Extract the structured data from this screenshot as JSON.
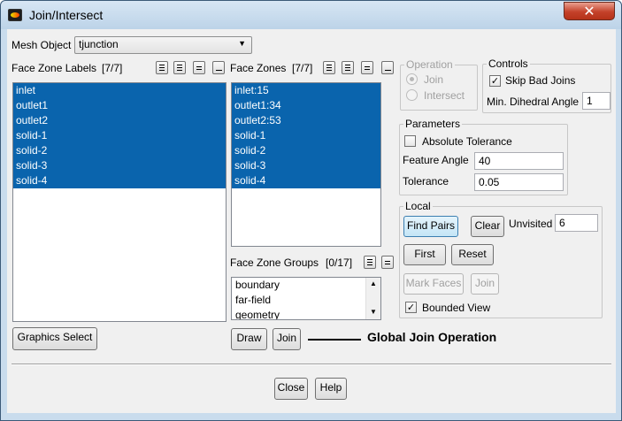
{
  "window": {
    "title": "Join/Intersect",
    "close_glyph": "✕"
  },
  "mesh_object": {
    "label": "Mesh Object",
    "value": "tjunction"
  },
  "face_zone_labels": {
    "label": "Face Zone Labels",
    "count": "[7/7]",
    "items": [
      {
        "text": "inlet",
        "selected": true
      },
      {
        "text": "outlet1",
        "selected": true
      },
      {
        "text": "outlet2",
        "selected": true
      },
      {
        "text": "solid-1",
        "selected": true
      },
      {
        "text": "solid-2",
        "selected": true
      },
      {
        "text": "solid-3",
        "selected": true
      },
      {
        "text": "solid-4",
        "selected": true
      }
    ]
  },
  "face_zones": {
    "label": "Face Zones",
    "count": "[7/7]",
    "items": [
      {
        "text": "inlet:15",
        "selected": true
      },
      {
        "text": "outlet1:34",
        "selected": true
      },
      {
        "text": "outlet2:53",
        "selected": true
      },
      {
        "text": "solid-1",
        "selected": true
      },
      {
        "text": "solid-2",
        "selected": true
      },
      {
        "text": "solid-3",
        "selected": true
      },
      {
        "text": "solid-4",
        "selected": true
      }
    ]
  },
  "face_zone_groups": {
    "label": "Face Zone Groups",
    "count": "[0/17]",
    "items": [
      "boundary",
      "far-field",
      "geometry"
    ]
  },
  "operation": {
    "title": "Operation",
    "join_label": "Join",
    "intersect_label": "Intersect",
    "selected": "Join"
  },
  "controls": {
    "title": "Controls",
    "skip_bad_joins_label": "Skip Bad Joins",
    "skip_bad_joins_checked": true,
    "min_dihedral_angle_label": "Min. Dihedral Angle",
    "min_dihedral_angle_value": "1"
  },
  "parameters": {
    "title": "Parameters",
    "absolute_tolerance_label": "Absolute Tolerance",
    "absolute_tolerance_checked": false,
    "feature_angle_label": "Feature Angle",
    "feature_angle_value": "40",
    "tolerance_label": "Tolerance",
    "tolerance_value": "0.05"
  },
  "local": {
    "title": "Local",
    "find_pairs_label": "Find Pairs",
    "clear_label": "Clear",
    "unvisited_label": "Unvisited",
    "unvisited_value": "6",
    "first_label": "First",
    "reset_label": "Reset",
    "mark_faces_label": "Mark Faces",
    "join_label": "Join",
    "bounded_view_label": "Bounded View",
    "bounded_view_checked": true
  },
  "bottom_left": {
    "graphics_select_label": "Graphics Select",
    "draw_label": "Draw",
    "join_label": "Join",
    "annotation": "Global Join Operation"
  },
  "footer": {
    "close_label": "Close",
    "help_label": "Help"
  },
  "colors": {
    "selection": "#0a64ad",
    "highlight_button": "#c4e5f6",
    "title_bar": "#c9dced",
    "close_button": "#c4412a"
  }
}
